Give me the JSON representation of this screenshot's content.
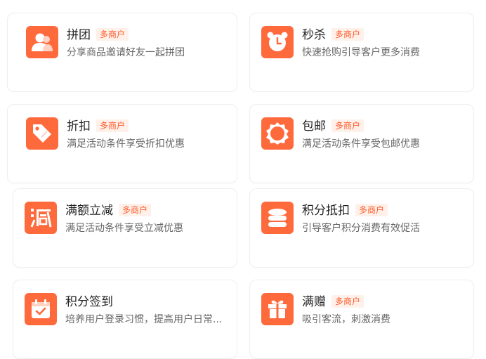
{
  "colors": {
    "accent": "#ff6a3d",
    "badge_text": "#ff5a2a",
    "badge_bg": "#fff1ea"
  },
  "cards": [
    {
      "title": "拼团",
      "badge": "多商户",
      "desc": "分享商品邀请好友一起拼团",
      "icon": "group-buy-icon"
    },
    {
      "title": "秒杀",
      "badge": "多商户",
      "desc": "快速抢购引导客户更多消费",
      "icon": "alarm-clock-icon"
    },
    {
      "title": "折扣",
      "badge": "多商户",
      "desc": "满足活动条件享受折扣优惠",
      "icon": "discount-tag-icon"
    },
    {
      "title": "包邮",
      "badge": "多商户",
      "desc": "满足活动条件享受包邮优惠",
      "icon": "free-shipping-seal-icon"
    },
    {
      "title": "满额立减",
      "badge": "多商户",
      "desc": "满足活动条件享受立减优惠",
      "icon": "reduce-icon"
    },
    {
      "title": "积分抵扣",
      "badge": "多商户",
      "desc": "引导客户积分消费有效促活",
      "icon": "coin-stack-icon"
    },
    {
      "title": "积分签到",
      "badge": "",
      "desc": "培养用户登录习惯，提高用户日常...",
      "icon": "calendar-check-icon"
    },
    {
      "title": "满赠",
      "badge": "多商户",
      "desc": "吸引客流，刺激消费",
      "icon": "gift-icon"
    }
  ]
}
